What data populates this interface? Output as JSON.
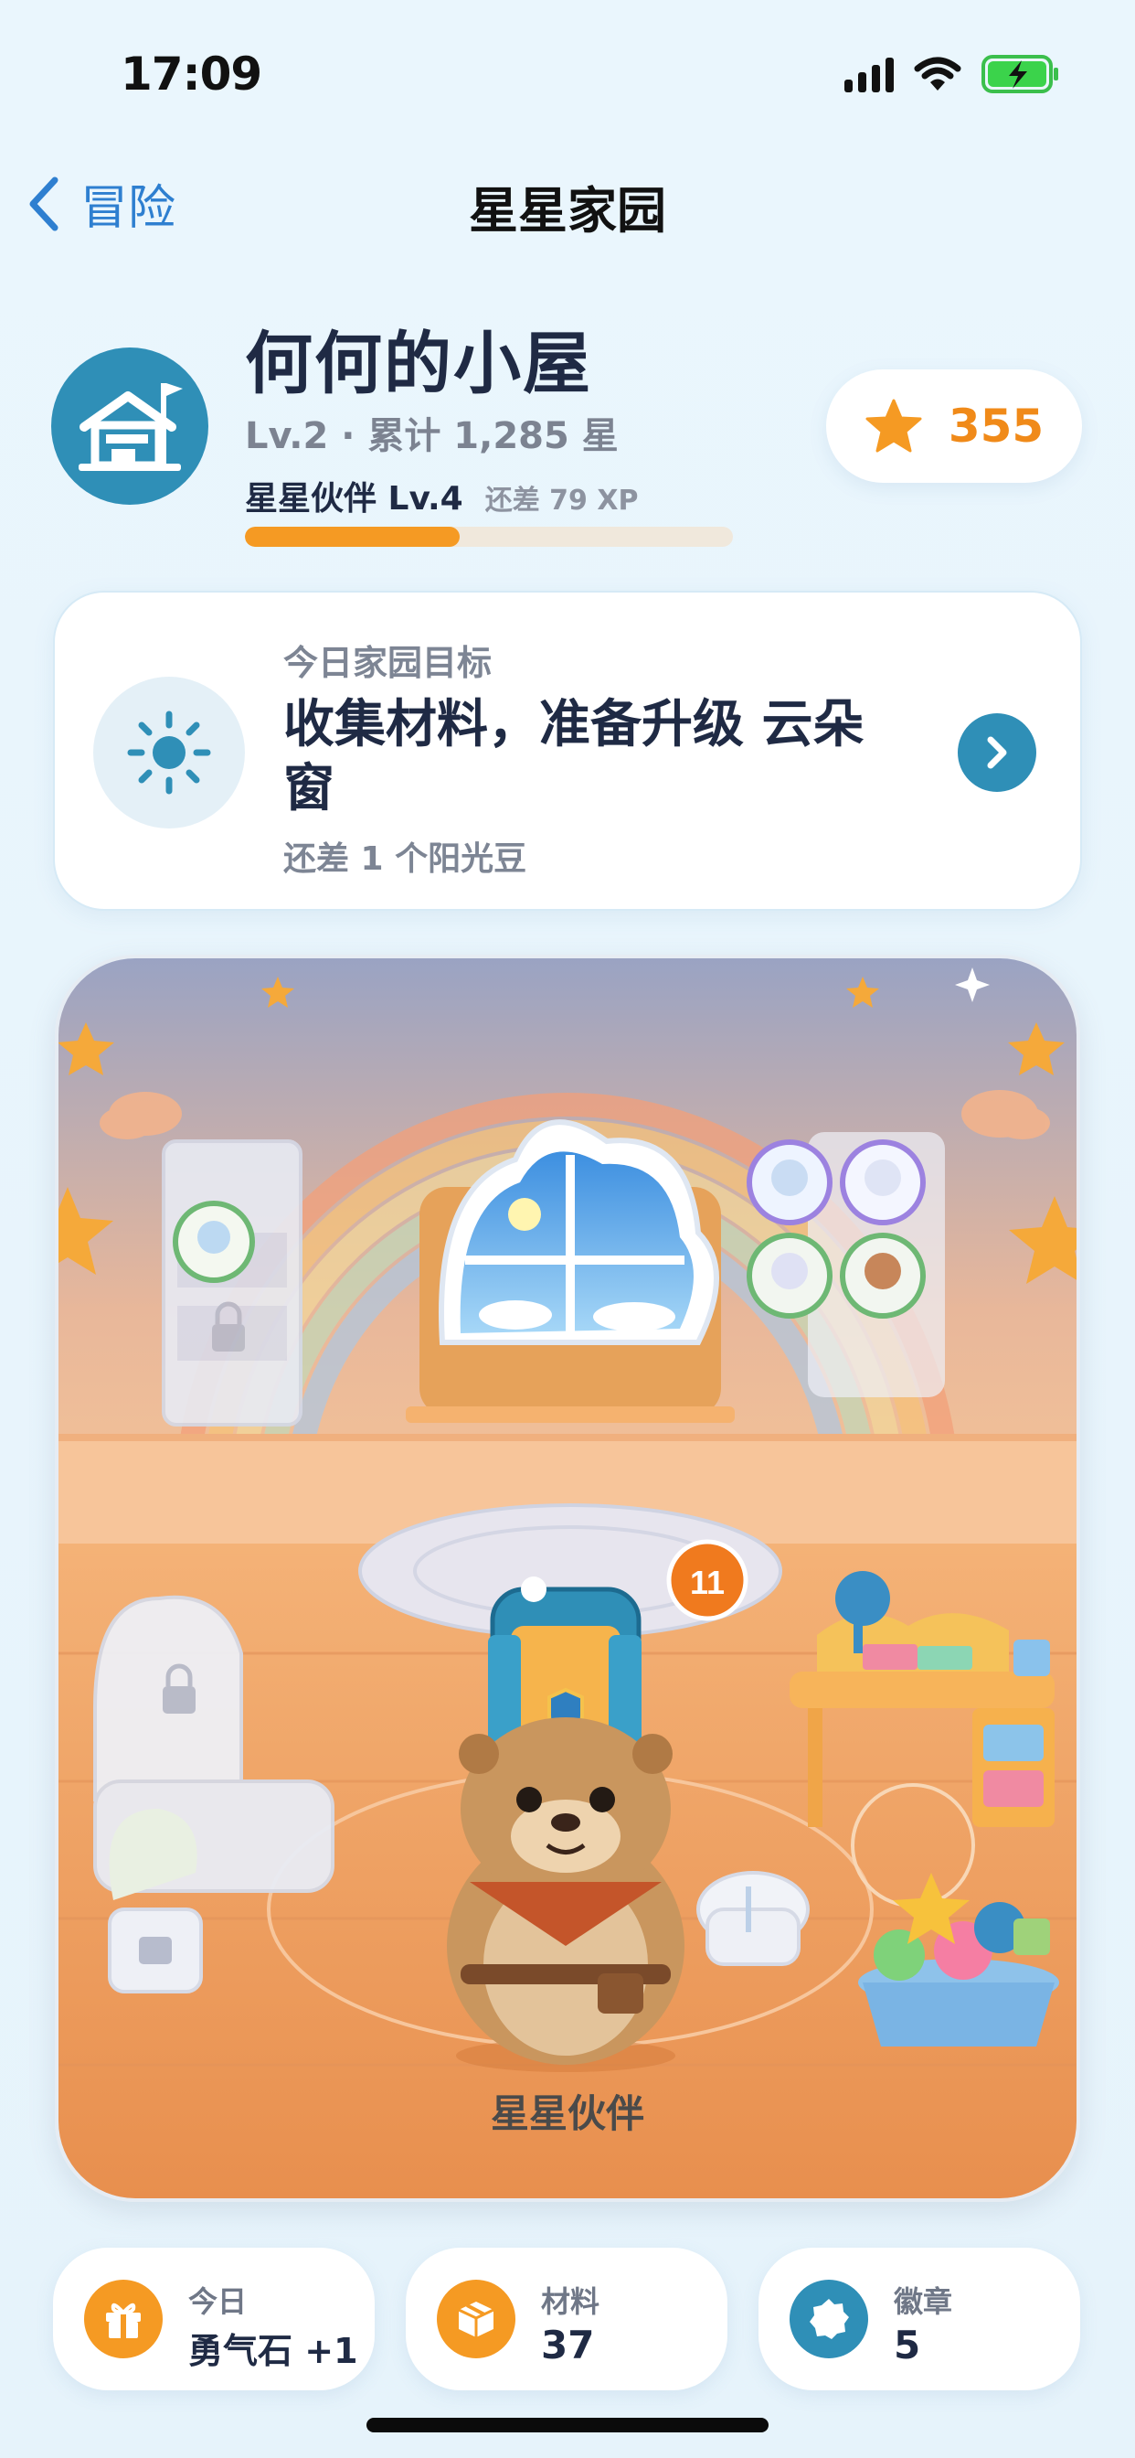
{
  "status_bar": {
    "time": "17:09"
  },
  "nav": {
    "back_label": "冒险",
    "title": "星星家园"
  },
  "header": {
    "house_name": "何何的小屋",
    "level_summary": "Lv.2 · 累计 1,285 星",
    "partner_level": "星星伙伴 Lv.4",
    "xp_remaining": "还差 79 XP",
    "xp_progress": 0.44,
    "star_count": "355"
  },
  "goal": {
    "label": "今日家园目标",
    "title": "收集材料，准备升级 云朵窗",
    "remaining": "还差 1 个阳光豆"
  },
  "room": {
    "chest_badge": "11",
    "partner_label": "星星伙伴"
  },
  "stats": [
    {
      "label": "今日",
      "value": "勇气石 +1",
      "icon": "gift-icon",
      "color": "#f59a23"
    },
    {
      "label": "材料",
      "value": "37",
      "icon": "box-icon",
      "color": "#f59a23"
    },
    {
      "label": "徽章",
      "value": "5",
      "icon": "badge-icon",
      "color": "#2f8fb7"
    }
  ],
  "colors": {
    "accent": "#2f8fb7",
    "orange": "#f59a23",
    "background": "#eaf5fc"
  }
}
